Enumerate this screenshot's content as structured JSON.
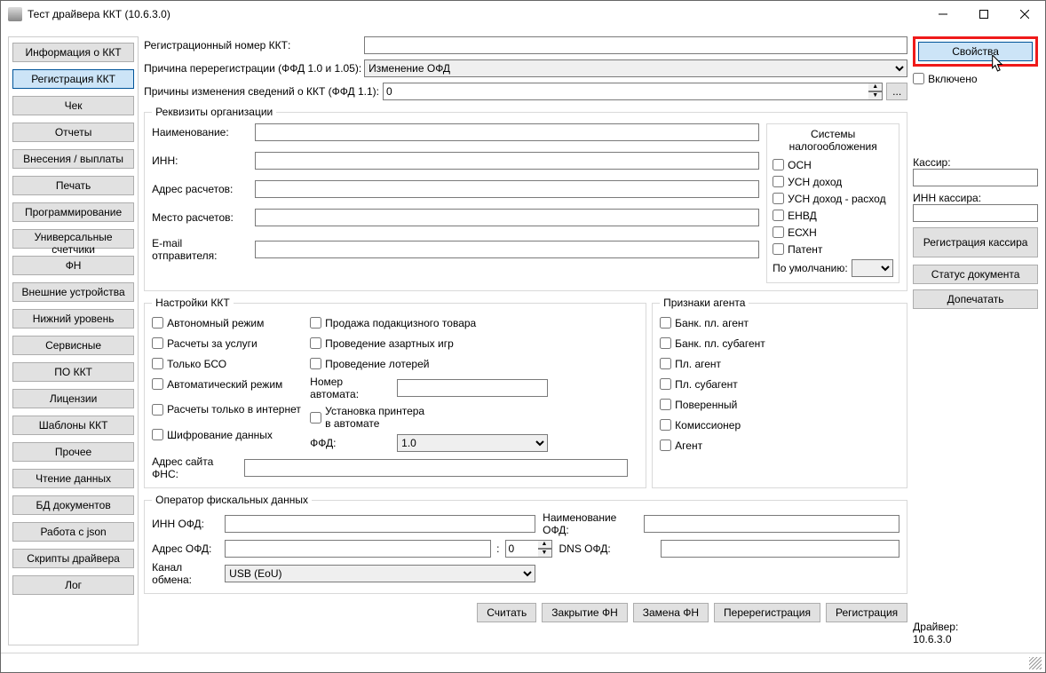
{
  "window": {
    "title": "Тест драйвера ККТ (10.6.3.0)"
  },
  "sidebar": {
    "items": [
      "Информация о ККТ",
      "Регистрация ККТ",
      "Чек",
      "Отчеты",
      "Внесения / выплаты",
      "Печать",
      "Программирование",
      "Универсальные счетчики",
      "ФН",
      "Внешние устройства",
      "Нижний уровень",
      "Сервисные",
      "ПО ККТ",
      "Лицензии",
      "Шаблоны ККТ",
      "Прочее",
      "Чтение данных",
      "БД документов",
      "Работа с json",
      "Скрипты драйвера",
      "Лог"
    ],
    "active_index": 1
  },
  "top": {
    "reg_number_label": "Регистрационный номер ККТ:",
    "rereg_reason_label": "Причина перерегистрации (ФФД 1.0 и 1.05):",
    "rereg_reason_value": "Изменение ОФД",
    "change_reasons_label": "Причины изменения сведений о ККТ (ФФД 1.1):",
    "change_reasons_value": "0",
    "dots": "..."
  },
  "org": {
    "legend": "Реквизиты организации",
    "name_label": "Наименование:",
    "inn_label": "ИНН:",
    "calc_addr_label": "Адрес расчетов:",
    "calc_place_label": "Место расчетов:",
    "email_label": "E-mail отправителя:",
    "tax": {
      "title": "Системы налогообложения",
      "items": [
        "ОСН",
        "УСН доход",
        "УСН доход - расход",
        "ЕНВД",
        "ЕСХН",
        "Патент"
      ],
      "default_label": "По умолчанию:"
    }
  },
  "kkt": {
    "legend": "Настройки ККТ",
    "col1": [
      "Автономный режим",
      "Расчеты за услуги",
      "Только БСО",
      "Автоматический режим",
      "Расчеты только в интернет",
      "Шифрование данных"
    ],
    "col2_checks": [
      "Продажа подакцизного товара",
      "Проведение азартных игр",
      "Проведение лотерей"
    ],
    "automat_label": "Номер автомата:",
    "printer_check": "Установка принтера в автомате",
    "ffd_label": "ФФД:",
    "ffd_value": "1.0",
    "fns_label": "Адрес сайта ФНС:",
    "agents": {
      "legend": "Признаки агента",
      "items": [
        "Банк. пл. агент",
        "Банк. пл. субагент",
        "Пл. агент",
        "Пл. субагент",
        "Поверенный",
        "Комиссионер",
        "Агент"
      ]
    }
  },
  "ofd": {
    "legend": "Оператор фискальных данных",
    "inn_label": "ИНН ОФД:",
    "name_label": "Наименование ОФД:",
    "addr_label": "Адрес ОФД:",
    "port_value": "0",
    "dns_label": "DNS ОФД:",
    "channel_label": "Канал обмена:",
    "channel_value": "USB (EoU)"
  },
  "footer_buttons": [
    "Считать",
    "Закрытие ФН",
    "Замена ФН",
    "Перерегистрация",
    "Регистрация"
  ],
  "right": {
    "properties_btn": "Свойства",
    "enabled_check": "Включено",
    "cashier_label": "Кассир:",
    "cashier_inn_label": "ИНН кассира:",
    "reg_cashier_btn": "Регистрация кассира",
    "status_btn": "Статус документа",
    "reprint_btn": "Допечатать",
    "driver_label": "Драйвер:",
    "driver_version": "10.6.3.0"
  }
}
